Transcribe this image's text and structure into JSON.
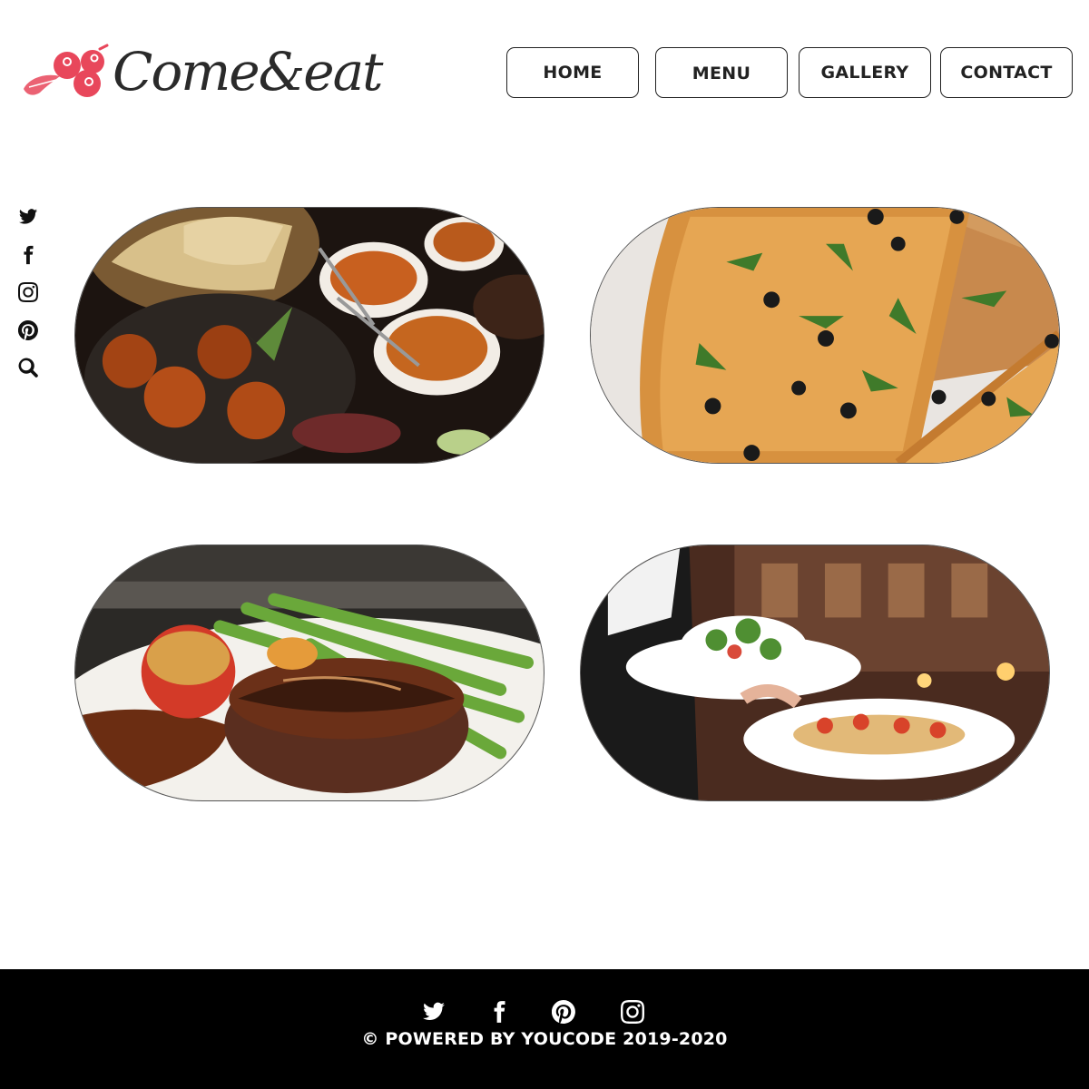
{
  "brand": {
    "name": "Come&eat",
    "accent_color": "#e8475b"
  },
  "nav": {
    "items": [
      {
        "label": "HOME"
      },
      {
        "label": "MENU"
      },
      {
        "label": "GALLERY"
      },
      {
        "label": "CONTACT"
      }
    ]
  },
  "side_social": {
    "icons": [
      "twitter-icon",
      "facebook-icon",
      "instagram-icon",
      "pinterest-icon",
      "search-icon"
    ]
  },
  "gallery": {
    "photos": [
      {
        "subject": "indian-food-platter-photo"
      },
      {
        "subject": "pizza-photo"
      },
      {
        "subject": "steak-with-asparagus-photo"
      },
      {
        "subject": "waiter-serving-plates-photo"
      }
    ]
  },
  "footer": {
    "icons": [
      "twitter-icon",
      "facebook-icon",
      "pinterest-icon",
      "instagram-icon"
    ],
    "copyright": "© POWERED BY YOUCODE 2019-2020",
    "background_color": "#000000"
  }
}
